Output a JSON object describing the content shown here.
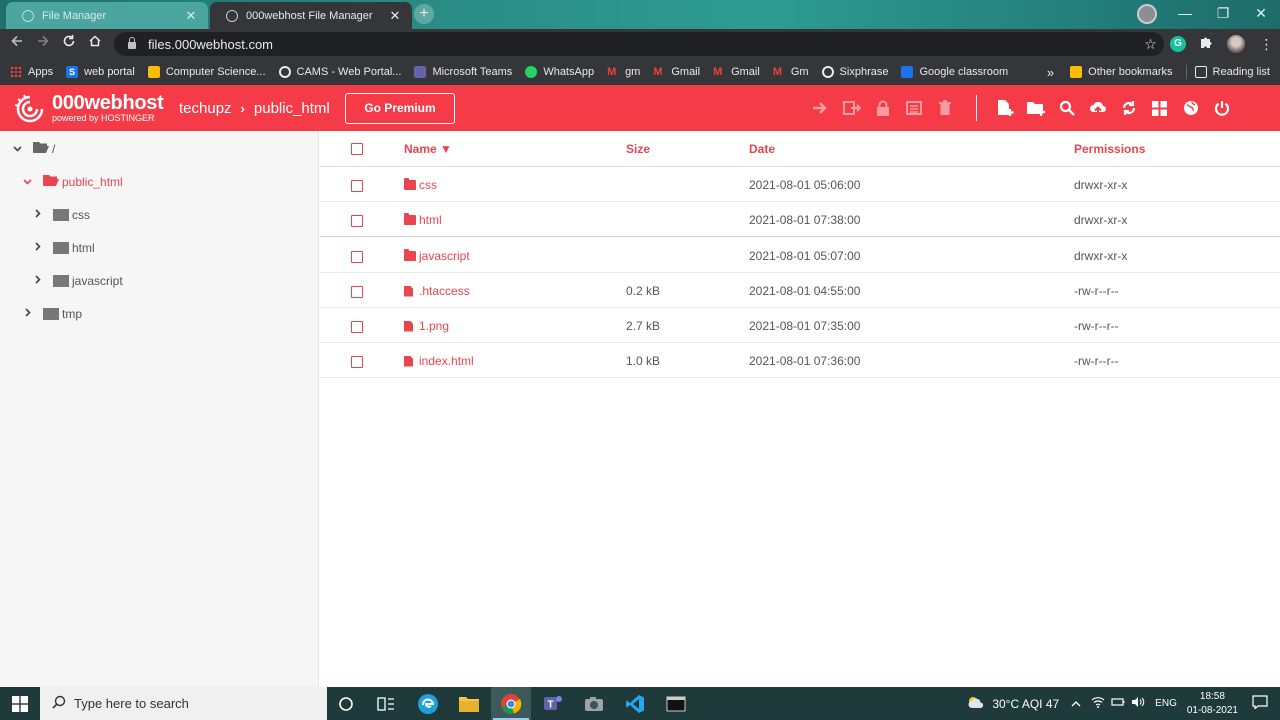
{
  "browser": {
    "tabs": [
      {
        "title": "File Manager",
        "active": false
      },
      {
        "title": "000webhost File Manager",
        "active": true
      }
    ],
    "new_tab": "+",
    "window_controls": {
      "minimize": "—",
      "restore": "❐",
      "close": "✕"
    },
    "url": "files.000webhost.com",
    "bookmarks": [
      {
        "label": "Apps",
        "icon": "apps-grid-icon",
        "color": "#f4b400"
      },
      {
        "label": "web portal",
        "icon": "portal-icon",
        "color": "#1a73e8"
      },
      {
        "label": "Computer Science...",
        "icon": "cs-icon",
        "color": "#fbbc04"
      },
      {
        "label": "CAMS - Web Portal...",
        "icon": "globe-icon",
        "color": "#e8eaed"
      },
      {
        "label": "Microsoft Teams",
        "icon": "teams-icon",
        "color": "#6264a7"
      },
      {
        "label": "WhatsApp",
        "icon": "whatsapp-icon",
        "color": "#25d366"
      },
      {
        "label": "gm",
        "icon": "gmail-icon",
        "color": "#ea4335"
      },
      {
        "label": "Gmail",
        "icon": "gmail-icon",
        "color": "#ea4335"
      },
      {
        "label": "Gmail",
        "icon": "gmail-icon",
        "color": "#ea4335"
      },
      {
        "label": "Gm",
        "icon": "gmail-icon",
        "color": "#ea4335"
      },
      {
        "label": "Sixphrase",
        "icon": "globe-icon",
        "color": "#e8eaed"
      },
      {
        "label": "Google classroom",
        "icon": "classroom-icon",
        "color": "#1a73e8"
      }
    ],
    "bookmarks_overflow": "»",
    "other_bookmarks": "Other bookmarks",
    "reading_list": "Reading list"
  },
  "app": {
    "brand": "000webhost",
    "brand_sub": "powered by HOSTINGER",
    "breadcrumb": [
      "techupz",
      "public_html"
    ],
    "breadcrumb_sep": "›",
    "premium_label": "Go Premium",
    "accent_color": "#f53b47",
    "toolbar_icons": [
      "move-icon",
      "rename-icon",
      "permissions-lock-icon",
      "archive-icon",
      "delete-icon",
      "new-file-icon",
      "new-folder-icon",
      "search-icon",
      "upload-icon",
      "refresh-icon",
      "grid-view-icon",
      "globe-icon",
      "power-icon"
    ]
  },
  "tree": {
    "root": "/",
    "items": [
      {
        "label": "public_html",
        "level": 1,
        "expanded": true,
        "active": true
      },
      {
        "label": "css",
        "level": 2,
        "expanded": false,
        "active": false
      },
      {
        "label": "html",
        "level": 2,
        "expanded": false,
        "active": false
      },
      {
        "label": "javascript",
        "level": 2,
        "expanded": false,
        "active": false
      },
      {
        "label": "tmp",
        "level": 1,
        "expanded": false,
        "active": false
      }
    ]
  },
  "table": {
    "columns": {
      "name": "Name ▼",
      "size": "Size",
      "date": "Date",
      "permissions": "Permissions"
    },
    "rows": [
      {
        "name": "css",
        "type": "folder",
        "size": "",
        "date": "2021-08-01 05:06:00",
        "permissions": "drwxr-xr-x"
      },
      {
        "name": "html",
        "type": "folder",
        "size": "",
        "date": "2021-08-01 07:38:00",
        "permissions": "drwxr-xr-x"
      },
      {
        "name": "javascript",
        "type": "folder",
        "size": "",
        "date": "2021-08-01 05:07:00",
        "permissions": "drwxr-xr-x"
      },
      {
        "name": ".htaccess",
        "type": "file",
        "size": "0.2 kB",
        "date": "2021-08-01 04:55:00",
        "permissions": "-rw-r--r--"
      },
      {
        "name": "1.png",
        "type": "file",
        "size": "2.7 kB",
        "date": "2021-08-01 07:35:00",
        "permissions": "-rw-r--r--"
      },
      {
        "name": "index.html",
        "type": "file",
        "size": "1.0 kB",
        "date": "2021-08-01 07:36:00",
        "permissions": "-rw-r--r--"
      }
    ]
  },
  "taskbar": {
    "search_placeholder": "Type here to search",
    "weather": "30°C  AQI 47",
    "language": "ENG",
    "time": "18:58",
    "date": "01-08-2021"
  }
}
